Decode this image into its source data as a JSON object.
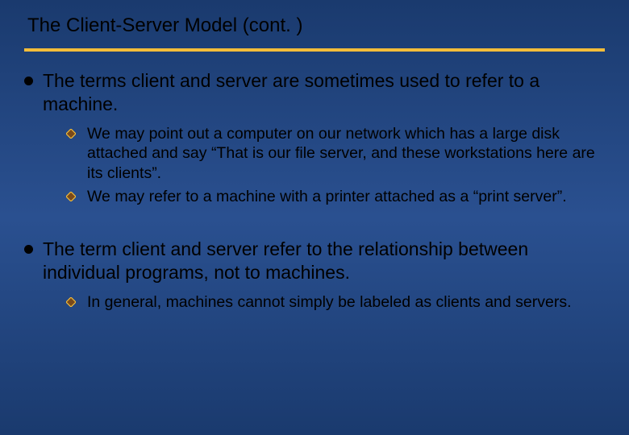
{
  "slide": {
    "title": "The Client-Server Model (cont. )",
    "bullets": [
      {
        "text": "The terms client and server are sometimes used to refer to a machine.",
        "sub": [
          "We may point out a computer on our network which has a large disk attached and say “That is our file server, and these workstations here are its clients”.",
          "We may refer to a machine with a printer attached as a “print server”."
        ]
      },
      {
        "text": "The term client and server refer to the relationship between individual programs, not to machines.",
        "sub": [
          "In general, machines cannot simply be labeled as clients and servers."
        ]
      }
    ]
  },
  "colors": {
    "accent": "#f3bd3a",
    "diamond_fill": "#7a4a1a",
    "diamond_edge": "#f3bd3a"
  }
}
